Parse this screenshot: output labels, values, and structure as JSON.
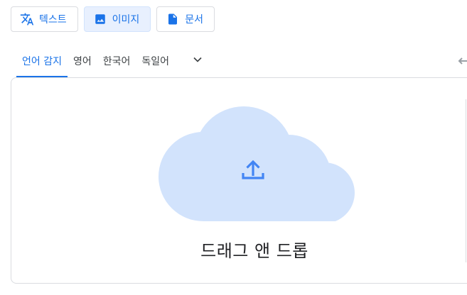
{
  "mode_buttons": [
    {
      "label": "텍스트",
      "icon": "translate-icon",
      "active": false
    },
    {
      "label": "이미지",
      "icon": "image-icon",
      "active": true
    },
    {
      "label": "문서",
      "icon": "document-icon",
      "active": false
    }
  ],
  "source_languages": {
    "tabs": [
      "언어 감지",
      "영어",
      "한국어",
      "독일어"
    ],
    "active_tab": "언어 감지",
    "more_icon": "chevron-down-icon"
  },
  "drop_area": {
    "label": "드래그 앤 드롭",
    "icon": "cloud-upload-icon"
  },
  "colors": {
    "accent": "#1a73e8",
    "cloud": "#d2e3fc",
    "upload_arrow": "#4285f4",
    "active_button_bg": "#e8f0fe",
    "border": "#dadce0"
  }
}
